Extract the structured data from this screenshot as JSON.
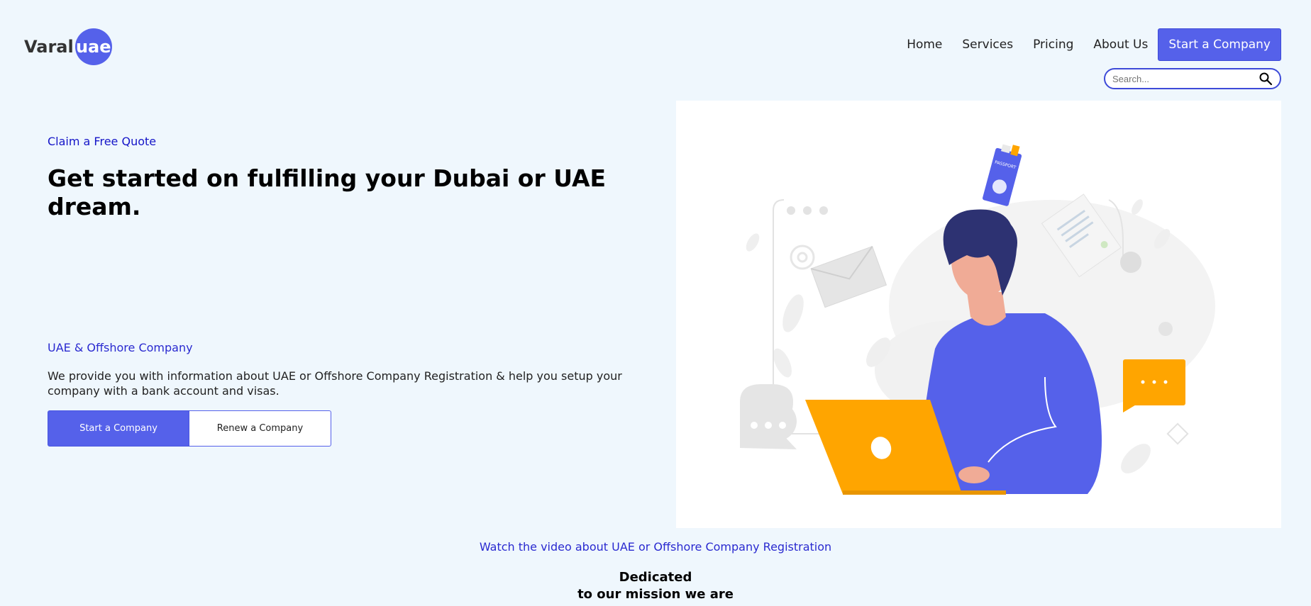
{
  "brand": {
    "name": "Varal",
    "badge": "uae",
    "color": "#5561ea"
  },
  "nav": {
    "links": [
      "Home",
      "Services",
      "Pricing",
      "About Us"
    ],
    "cta": "Start a Company"
  },
  "search": {
    "placeholder": "Search...",
    "icon": "search-icon"
  },
  "hero": {
    "eyebrow": "Claim a Free Quote",
    "title": "Get started on fulfilling your Dubai or UAE dream.",
    "sub_eyebrow": "UAE & Offshore Company",
    "description": "We provide you with information about UAE or Offshore Company Registration & help you setup your company with a bank account and visas.",
    "primary_button": "Start a Company",
    "secondary_button": "Renew a Company"
  },
  "illustration": {
    "passport_label": "PASSPORT",
    "accent": "#ffa500",
    "primary": "#5561ea"
  },
  "video_link": "Watch the video about UAE or Offshore Company Registration",
  "mission": {
    "line1": "Dedicated",
    "line2": "to our mission we are"
  }
}
